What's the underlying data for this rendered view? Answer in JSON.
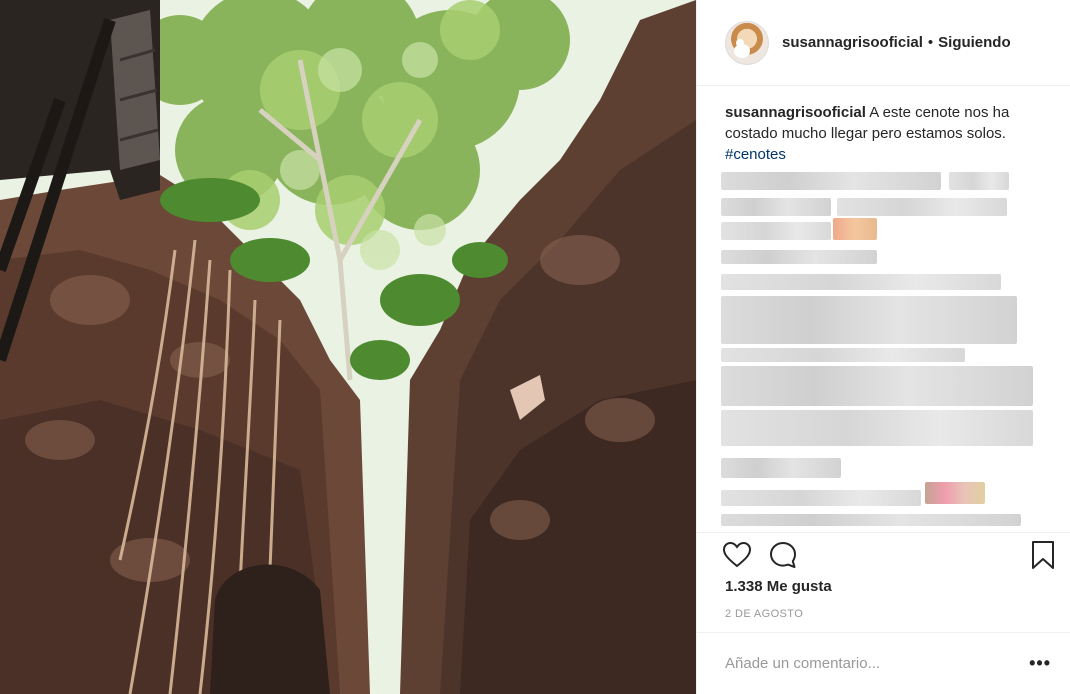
{
  "post": {
    "image_alt": "cenote",
    "header": {
      "username": "susannagrisooficial",
      "separator": "•",
      "follow_status": "Siguiendo"
    },
    "caption": {
      "username": "susannagrisooficial",
      "text": "A este cenote nos ha costado mucho llegar pero estamos solos.",
      "hashtag": "#cenotes"
    },
    "actions": {
      "like_icon": "heart-icon",
      "comment_icon": "comment-bubble-icon",
      "save_icon": "bookmark-icon"
    },
    "likes": "1.338 Me gusta",
    "date": "2 DE AGOSTO",
    "comment_box": {
      "placeholder": "Añade un comentario...",
      "more_icon": "more-options-icon",
      "more_label": "•••"
    }
  },
  "colors": {
    "text": "#262626",
    "hashtag": "#003569",
    "muted": "#999999",
    "divider": "#efefef"
  }
}
